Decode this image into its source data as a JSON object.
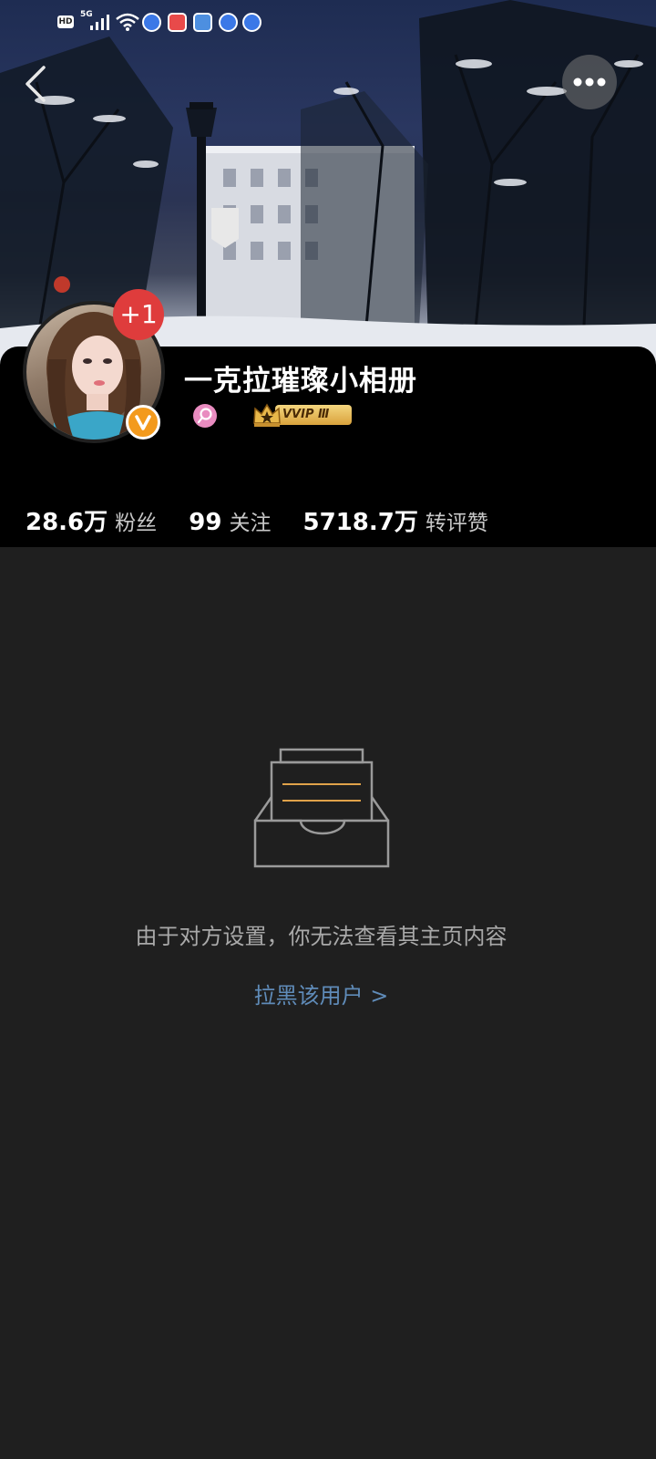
{
  "status_bar": {
    "hd": "HD",
    "network": "5G",
    "icons": [
      "signal-icon",
      "wifi-icon",
      "app-notification-icon",
      "app-notification-icon",
      "app-notification-icon",
      "app-notification-icon",
      "app-notification-icon"
    ]
  },
  "nav": {
    "back_icon": "chevron-left-icon",
    "more_icon": "more-dots-icon"
  },
  "profile": {
    "username": "一克拉璀璨小相册",
    "new_avatar_badge": "+1",
    "verified_icon": "verified-v-icon",
    "search_icon": "search-icon",
    "vip_label": "VVIP Ⅲ"
  },
  "stats": [
    {
      "value": "28.6万",
      "label": "粉丝"
    },
    {
      "value": "99",
      "label": "关注"
    },
    {
      "value": "5718.7万",
      "label": "转评赞"
    }
  ],
  "empty_state": {
    "icon": "inbox-tray-icon",
    "message": "由于对方设置，你无法查看其主页内容",
    "block_link": "拉黑该用户 >"
  },
  "colors": {
    "page_background": "#1f1f1f",
    "header_background": "#000000",
    "link": "#5f8bb8",
    "badge_red": "#df3c3c",
    "verified_orange": "#f39a1d"
  }
}
